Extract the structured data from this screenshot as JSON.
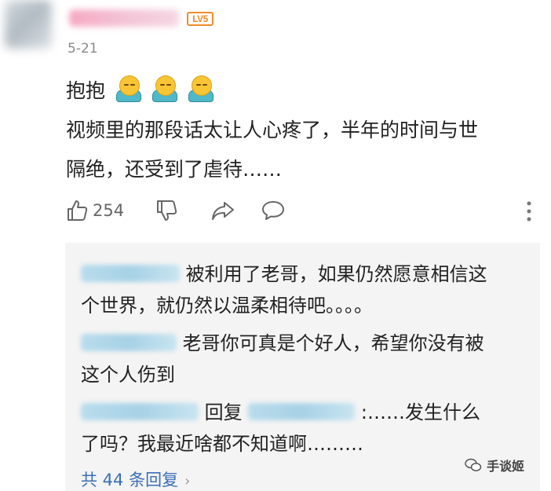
{
  "comment": {
    "level_badge": "LV5",
    "date": "5-21",
    "text_line1": "抱抱",
    "text_line2": "视频里的那段话太让人心疼了，半年的时间与世",
    "text_line3": "隔绝，还受到了虐待……",
    "emojis": [
      "hug-emoji",
      "hug-emoji",
      "hug-emoji"
    ],
    "like_count": "254"
  },
  "replies": [
    {
      "line1": "被利用了老哥，如果仍然愿意相信这",
      "line2": "个世界，就仍然以温柔相待吧。。。。"
    },
    {
      "line1": "老哥你可真是个好人，希望你没有被",
      "line2": "这个人伤到"
    },
    {
      "reply_word": "回复",
      "line1_tail": ":……发生什么",
      "line2": "了吗？我最近啥都不知道啊………"
    }
  ],
  "more_replies_label": "共 44 条回复",
  "watermark": "手谈姬",
  "colors": {
    "link": "#3b6fb6",
    "badge": "#f28c28",
    "reply_bg": "#f4f4f4",
    "muted": "#8a8a8a"
  }
}
